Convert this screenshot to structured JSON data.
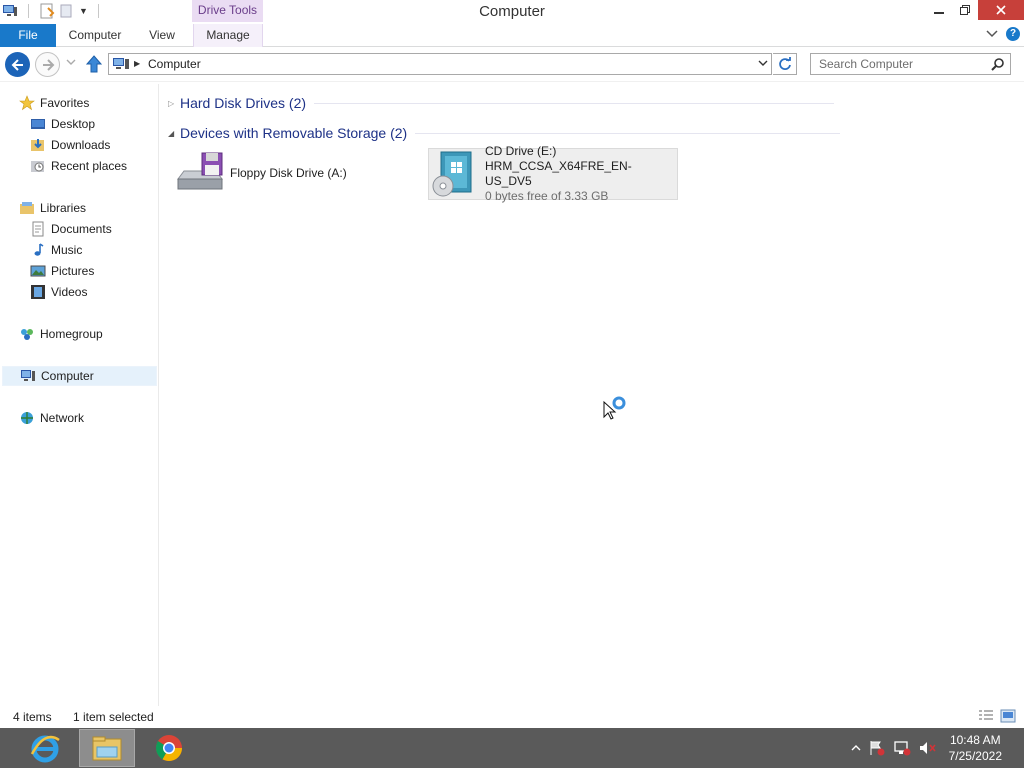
{
  "window": {
    "title": "Computer",
    "context_tab": "Drive Tools"
  },
  "ribbon": {
    "tabs": [
      {
        "label": "File"
      },
      {
        "label": "Computer"
      },
      {
        "label": "View"
      },
      {
        "label": "Manage"
      }
    ]
  },
  "address": {
    "path": "Computer"
  },
  "search": {
    "placeholder": "Search Computer"
  },
  "sidebar": {
    "favorites": {
      "label": "Favorites",
      "items": [
        {
          "label": "Desktop",
          "icon": "desktop-icon"
        },
        {
          "label": "Downloads",
          "icon": "downloads-icon"
        },
        {
          "label": "Recent places",
          "icon": "recent-places-icon"
        }
      ]
    },
    "libraries": {
      "label": "Libraries",
      "items": [
        {
          "label": "Documents",
          "icon": "documents-icon"
        },
        {
          "label": "Music",
          "icon": "music-icon"
        },
        {
          "label": "Pictures",
          "icon": "pictures-icon"
        },
        {
          "label": "Videos",
          "icon": "videos-icon"
        }
      ]
    },
    "homegroup": {
      "label": "Homegroup"
    },
    "computer": {
      "label": "Computer",
      "selected": true
    },
    "network": {
      "label": "Network"
    }
  },
  "content": {
    "groups": [
      {
        "label": "Hard Disk Drives (2)",
        "expanded": false
      },
      {
        "label": "Devices with Removable Storage (2)",
        "expanded": true
      }
    ],
    "drives": [
      {
        "name": "Floppy Disk Drive (A:)",
        "icon": "floppy-drive-icon",
        "selected": false
      },
      {
        "name": "CD Drive (E:)",
        "volume": "HRM_CCSA_X64FRE_EN-US_DV5",
        "free": "0 bytes free of 3.33 GB",
        "icon": "cd-drive-icon",
        "selected": true
      }
    ]
  },
  "statusbar": {
    "items_count": "4 items",
    "selection": "1 item selected"
  },
  "taskbar": {
    "apps": [
      {
        "name": "Internet Explorer",
        "icon": "internet-explorer-icon",
        "active": false
      },
      {
        "name": "File Explorer",
        "icon": "file-explorer-icon",
        "active": true
      },
      {
        "name": "Google Chrome",
        "icon": "chrome-icon",
        "active": false
      }
    ],
    "clock": {
      "time": "10:48 AM",
      "date": "7/25/2022"
    }
  },
  "colors": {
    "accent": "#1979ca",
    "context_tab_bg": "#eadcf3",
    "group_header": "#1e3287",
    "taskbar": "#5a5a5a",
    "close_button": "#c7403a"
  }
}
